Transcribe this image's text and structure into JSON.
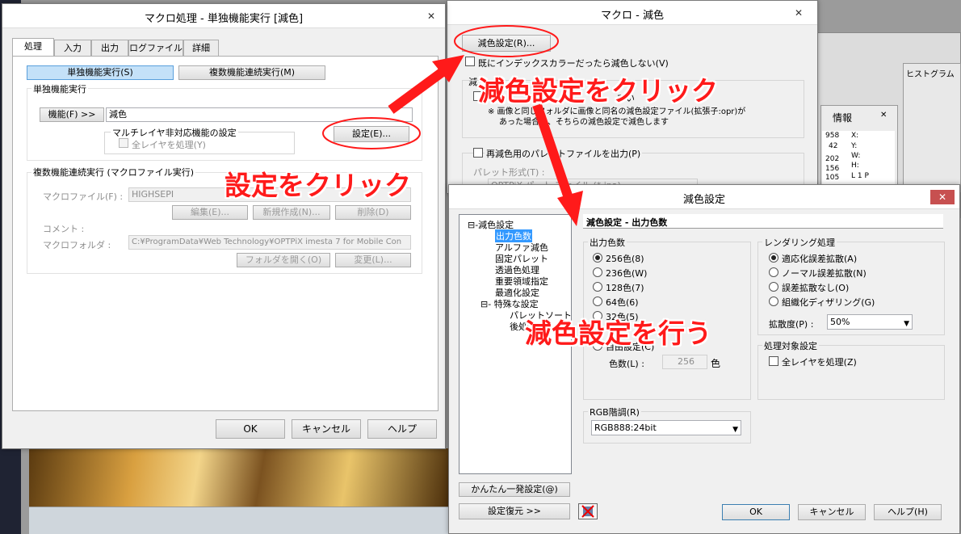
{
  "macro_window": {
    "title": "マクロ処理 - 単独機能実行 [減色]",
    "close": "✕",
    "tabs": [
      "処理",
      "入力",
      "出力",
      "ログファイル",
      "詳細"
    ],
    "mode_single": "単独機能実行(S)",
    "mode_multi": "複数機能連続実行(M)",
    "single_group": "単独機能実行",
    "function_button": "機能(F) >>",
    "function_value": "減色",
    "multilayer_group": "マルチレイヤ非対応機能の設定",
    "all_layers": "全レイヤを処理(Y)",
    "settings_button": "設定(E)...",
    "multi_group": "複数機能連続実行 (マクロファイル実行)",
    "macro_file_label": "マクロファイル(F) :",
    "macro_file_value": "HIGHSEPI",
    "edit_button": "編集(E)...",
    "new_button": "新規作成(N)...",
    "delete_button": "削除(D)",
    "comment_label": "コメント :",
    "macro_folder_label": "マクロフォルダ :",
    "macro_folder_value": "C:¥ProgramData¥Web Technology¥OPTPiX imesta 7 for Mobile Con",
    "open_folder_button": "フォルダを開く(O)",
    "change_button": "変更(L)...",
    "ok": "OK",
    "cancel": "キャンセル",
    "help": "ヘルプ"
  },
  "reduce_window": {
    "title": "マクロ - 減色",
    "close": "✕",
    "settings_button": "減色設定(R)...",
    "no_reduce_indexed": "既にインデックスカラーだったら減色しない(V)",
    "frag1": "減",
    "frag2": "てい",
    "note1": "※ 画像と同じフォルダに画像と同名の減色設定ファイル(拡張子:opr)が",
    "note2": "あった場合は、そちらの減色設定で減色します",
    "palette_output": "再減色用のパレットファイルを出力(P)",
    "palette_format": "パレット形式(T) :",
    "palette_format_frag": "OPTPiX パ…ト ファイル (*.ipa)"
  },
  "bg_window": {
    "histogram": "ヒストグラム",
    "info": "情報",
    "close": "✕",
    "nums": [
      "958",
      "42",
      "202",
      "156",
      "105"
    ],
    "letters": [
      "X:",
      "Y:",
      "W:",
      "H:",
      "L 1   P"
    ]
  },
  "color_window": {
    "title": "減色設定",
    "close": "✕",
    "tree": [
      {
        "label": "⊟-減色設定",
        "indent": 0
      },
      {
        "label": "出力色数",
        "indent": 1,
        "selected": true
      },
      {
        "label": "アルファ減色",
        "indent": 1
      },
      {
        "label": "固定パレット",
        "indent": 1
      },
      {
        "label": "透過色処理",
        "indent": 1
      },
      {
        "label": "重要領域指定",
        "indent": 1
      },
      {
        "label": "最適化設定",
        "indent": 1
      },
      {
        "label": "⊟- 特殊な設定",
        "indent": 1
      },
      {
        "label": "パレットソート",
        "indent": 2
      },
      {
        "label": "後処理",
        "indent": 2
      }
    ],
    "section_title": "減色設定 - 出力色数",
    "output_group": "出力色数",
    "output_options": [
      "256色(8)",
      "236色(W)",
      "128色(7)",
      "64色(6)",
      "32色(5)"
    ],
    "free_setting": "自由設定(C)",
    "color_count_label": "色数(L) :",
    "color_count_value": "256",
    "color_unit": "色",
    "render_group": "レンダリング処理",
    "render_options": [
      "適応化誤差拡散(A)",
      "ノーマル誤差拡散(N)",
      "誤差拡散なし(O)",
      "組織化ディザリング(G)"
    ],
    "diffusion_label": "拡散度(P) :",
    "diffusion_value": "50%",
    "target_group": "処理対象設定",
    "all_layers_process": "全レイヤを処理(Z)",
    "rgb_group": "RGB階調(R)",
    "rgb_value": "RGB888:24bit",
    "quick_button": "かんたん一発設定(@)",
    "restore_button": "設定復元 >>",
    "ok": "OK",
    "cancel": "キャンセル",
    "help": "ヘルプ(H)"
  },
  "annotations": {
    "reduce_click": "減色設定をクリック",
    "setting_click": "設定をクリック",
    "do_reduce": "減色設定を行う"
  },
  "colors": {
    "annotation_red": "#ff1a1a",
    "selection_blue": "#3399ff"
  }
}
